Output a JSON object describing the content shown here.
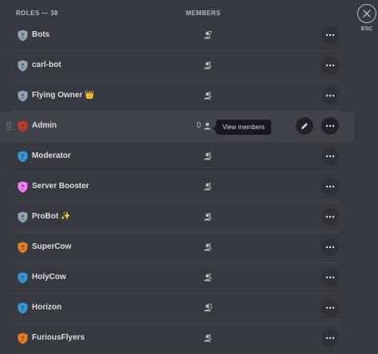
{
  "header": {
    "roles": "ROLES — 38",
    "members": "MEMBERS"
  },
  "esc": {
    "label": "ESC"
  },
  "tooltip": "View members",
  "roles": [
    {
      "name": "Bots",
      "count": "7",
      "color": "#8fa6b2",
      "badge": ""
    },
    {
      "name": "carl-bot",
      "count": "1",
      "color": "#8fa6b2",
      "badge": ""
    },
    {
      "name": "Flying Owner",
      "count": "1",
      "color": "#8fa6b2",
      "badge": "👑"
    },
    {
      "name": "Admin",
      "count": "0",
      "color": "#c0392b",
      "badge": ""
    },
    {
      "name": "Moderator",
      "count": "1",
      "color": "#3498db",
      "badge": ""
    },
    {
      "name": "Server Booster",
      "count": "1",
      "color": "#f47fff",
      "badge": ""
    },
    {
      "name": "ProBot",
      "count": "1",
      "color": "#8fa6b2",
      "badge": "✨"
    },
    {
      "name": "SuperCow",
      "count": "1",
      "color": "#e67e22",
      "badge": ""
    },
    {
      "name": "HolyCow",
      "count": "1",
      "color": "#3498db",
      "badge": ""
    },
    {
      "name": "Horizon",
      "count": "0",
      "color": "#3498db",
      "badge": ""
    },
    {
      "name": "FuriousFlyers",
      "count": "1",
      "color": "#e67e22",
      "badge": ""
    }
  ]
}
